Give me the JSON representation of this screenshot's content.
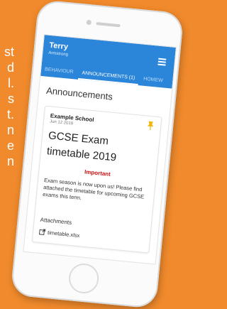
{
  "colors": {
    "background": "#f08a2c",
    "appbar": "#2b86d9",
    "important": "#cc1111",
    "pin": "#f2b705"
  },
  "side_text": [
    "st",
    "d",
    "l.",
    "s",
    "t.",
    "n",
    "e",
    "n"
  ],
  "header": {
    "user_name": "Terry",
    "user_sub": "Armstrong",
    "menu_icon": "hamburger-menu-icon"
  },
  "tabs": [
    {
      "label": "BEHAVIOUR"
    },
    {
      "label": "ANNOUNCEMENTS (1)"
    },
    {
      "label": "HOMEW"
    }
  ],
  "page_title": "Announcements",
  "announcement": {
    "school": "Example School",
    "date": "Jun 12 2019",
    "title": "GCSE Exam timetable 2019",
    "badge": "Important",
    "body": "Exam season is now upon us! Please find attached the timetable for upcoming GCSE exams this term.",
    "pin_icon": "pin-icon"
  },
  "attachments": {
    "heading": "Attachments",
    "files": [
      {
        "name": "timetable.xlsx",
        "icon": "external-link-icon"
      }
    ]
  }
}
